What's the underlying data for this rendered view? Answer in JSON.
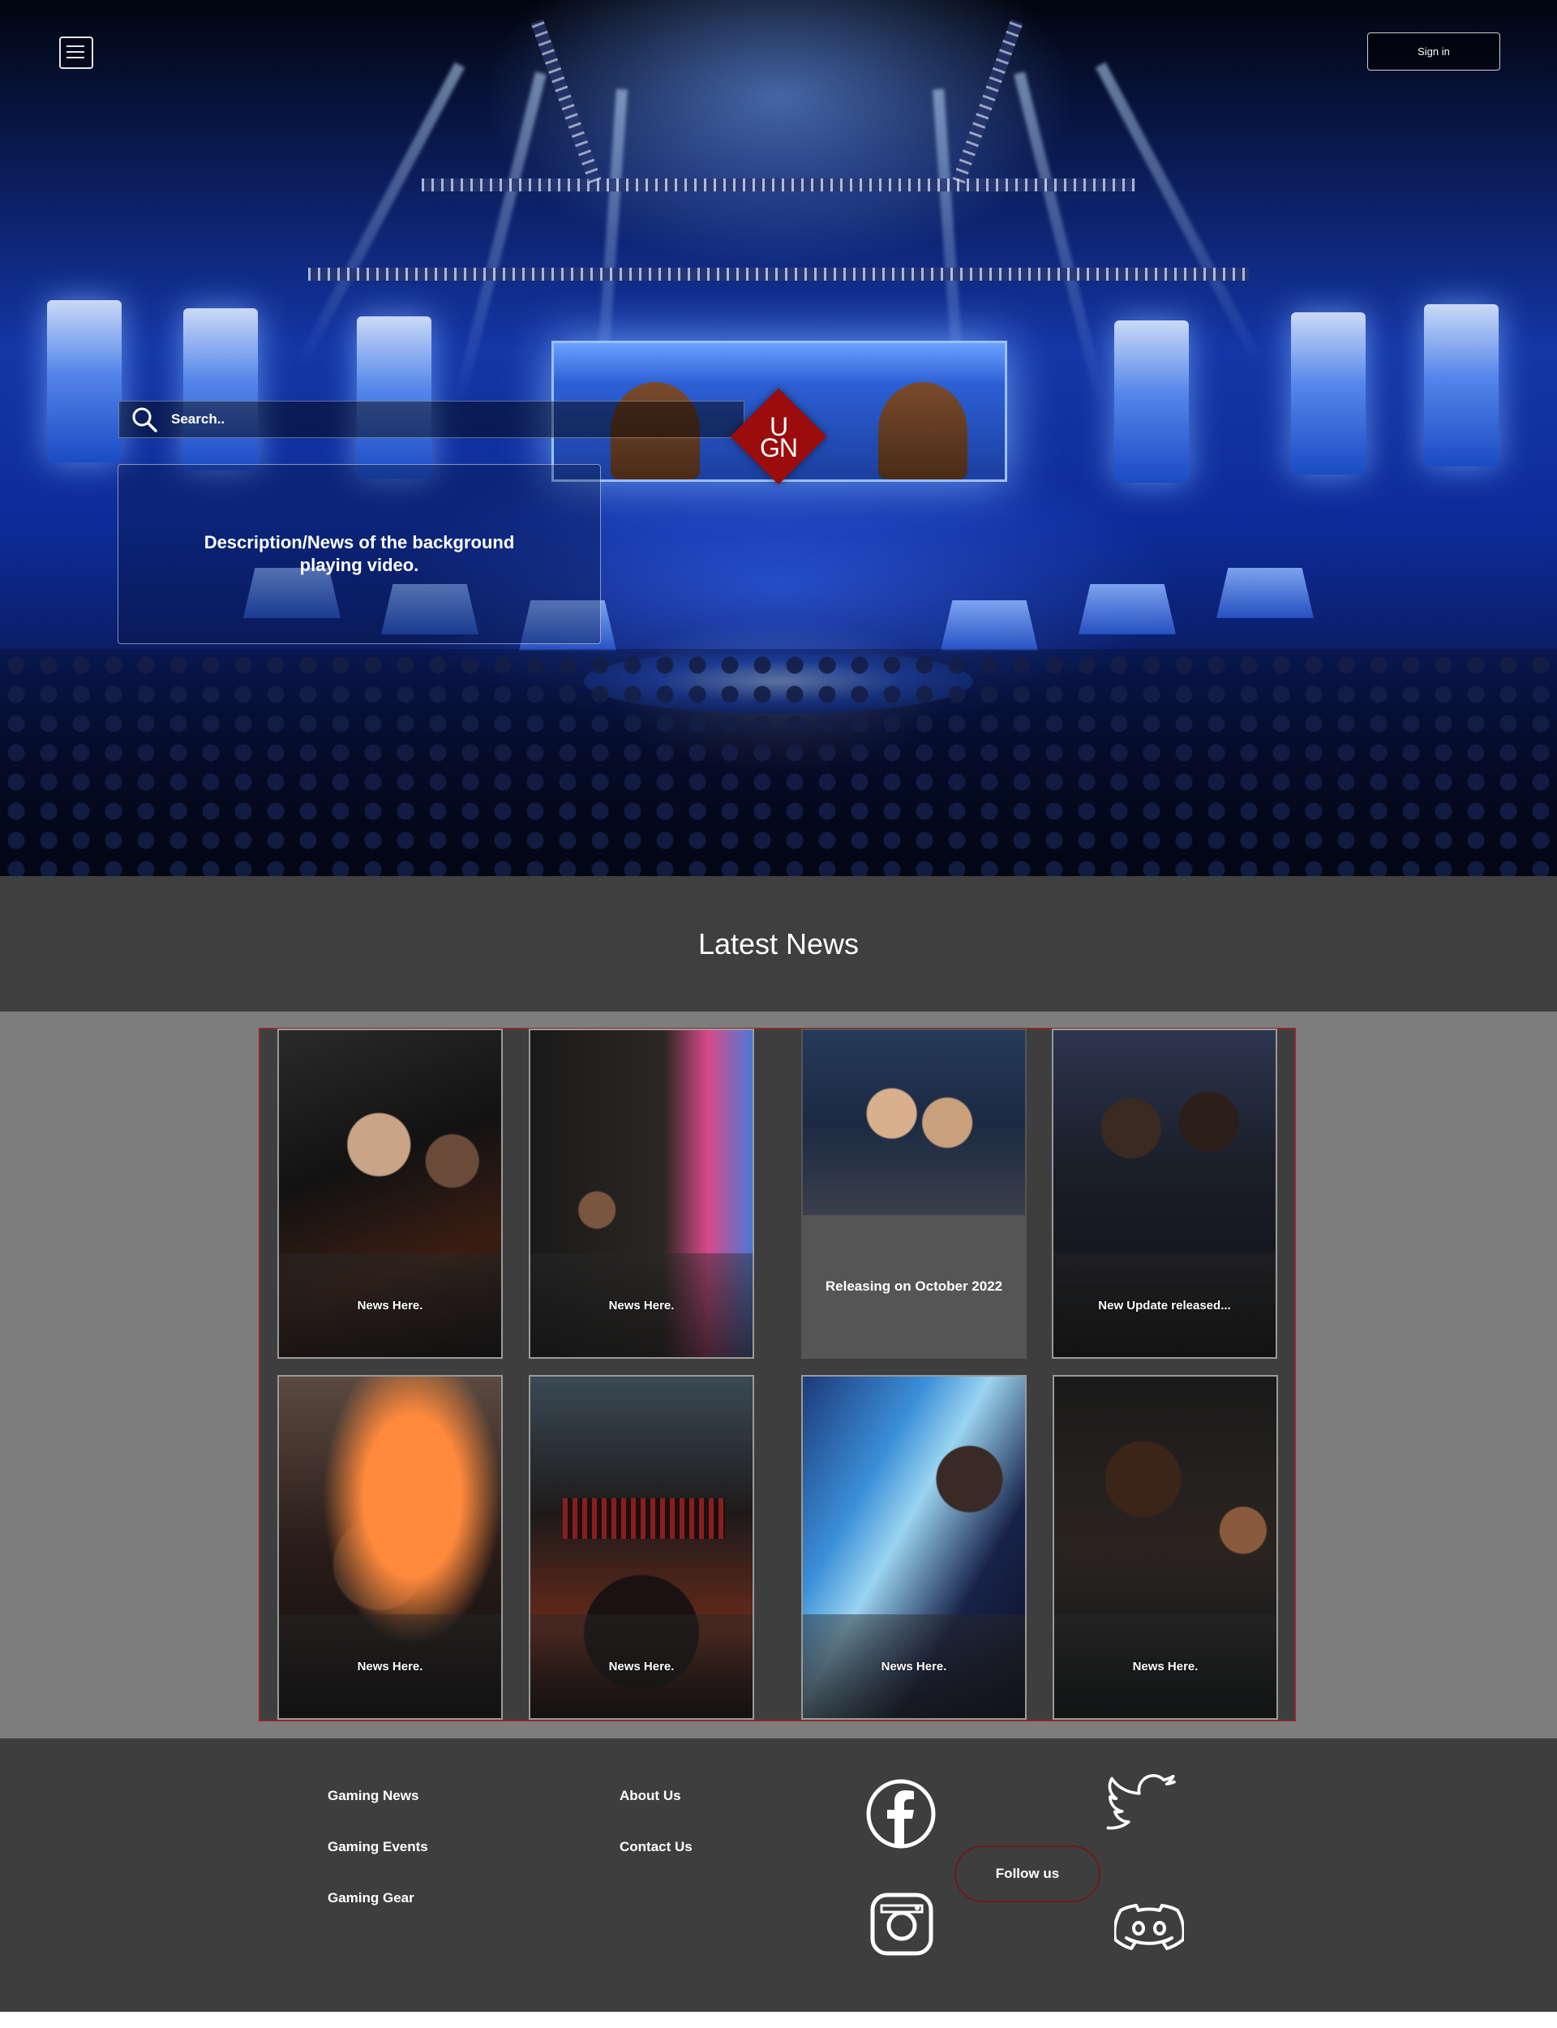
{
  "header": {
    "signin_label": "Sign in",
    "menu_icon": "hamburger-menu-icon"
  },
  "hero": {
    "search_placeholder": "Search..",
    "search_icon": "search-icon",
    "description": "Description/News of the background playing video.",
    "logo_top": "U",
    "logo_bottom": "GN",
    "logo_color": "#9b0c0c"
  },
  "news": {
    "title": "Latest News",
    "cards": [
      {
        "text": "News Here."
      },
      {
        "text": "News Here."
      },
      {
        "text": "Releasing on October 2022"
      },
      {
        "text": "New Update released..."
      },
      {
        "text": "News Here."
      },
      {
        "text": "News Here."
      },
      {
        "text": "News Here."
      },
      {
        "text": "News Here."
      }
    ]
  },
  "footer": {
    "links_col1": [
      "Gaming News",
      "Gaming Events",
      "Gaming Gear"
    ],
    "links_col2": [
      "About Us",
      "Contact Us"
    ],
    "follow_label": "Follow us",
    "social_icons": [
      "facebook-icon",
      "twitter-icon",
      "instagram-icon",
      "discord-icon"
    ]
  },
  "colors": {
    "accent_red": "#9b0c0c",
    "border_red": "#8a2b2b",
    "dark_bg": "#3e3e3e",
    "gray_bg": "#7d7d7d"
  }
}
